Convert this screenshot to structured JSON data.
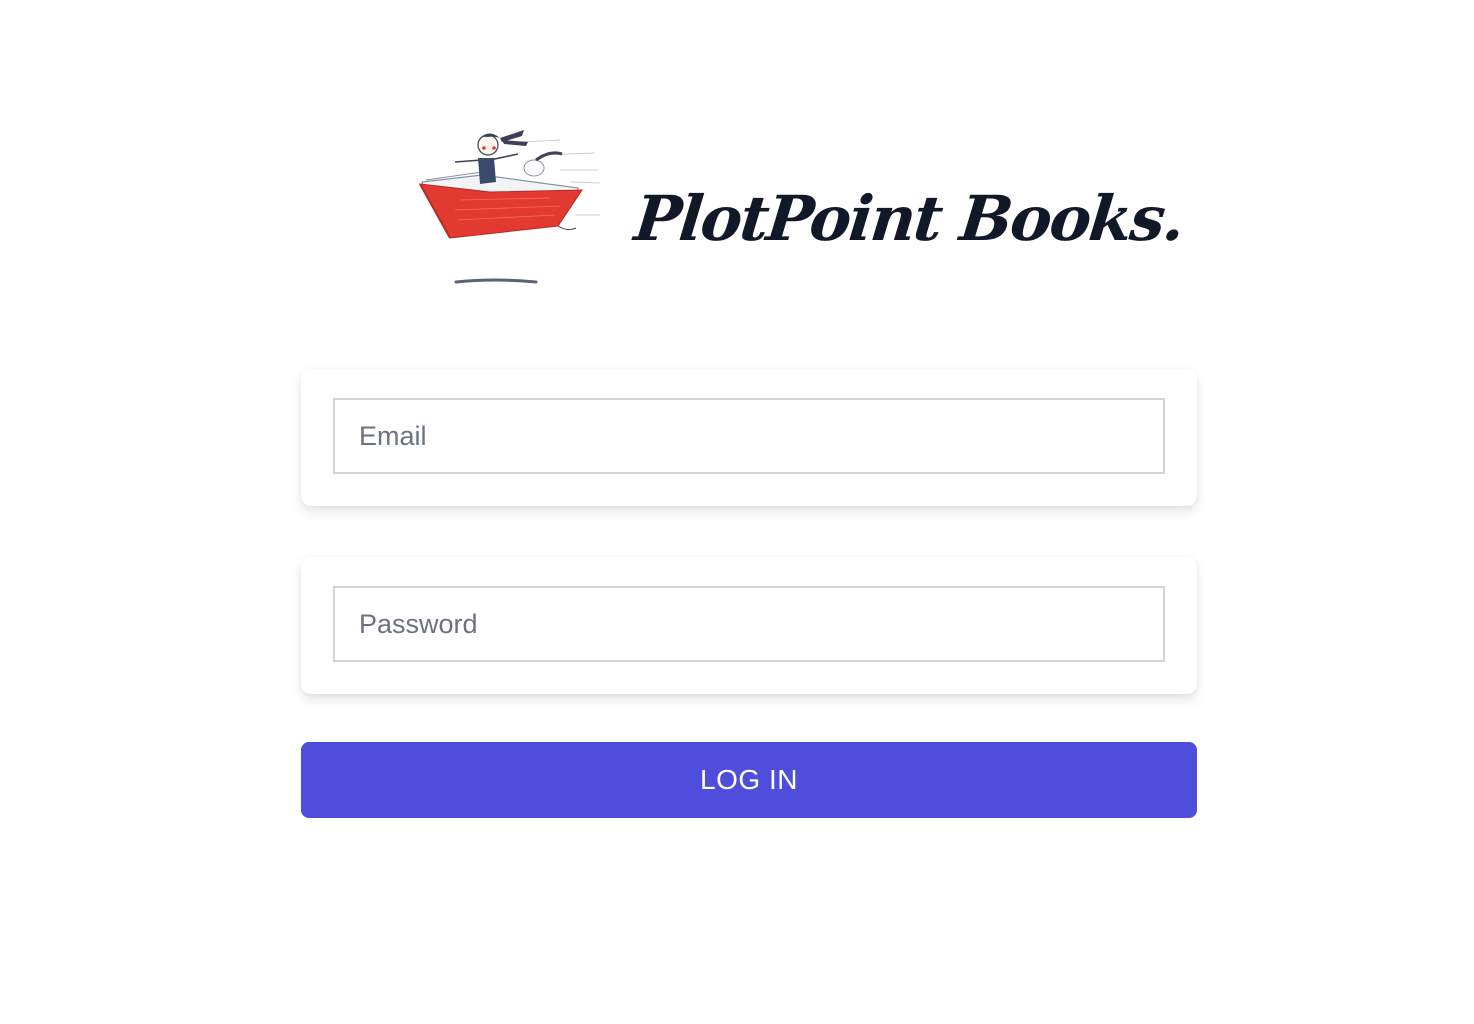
{
  "brand": {
    "name": "PlotPoint Books.",
    "logo_icon": "girl-flying-on-book-illustration"
  },
  "form": {
    "email": {
      "placeholder": "Email",
      "value": ""
    },
    "password": {
      "placeholder": "Password",
      "value": ""
    },
    "submit_label": "LOG IN"
  },
  "colors": {
    "accent": "#4f4edc",
    "book_red": "#e23a30",
    "brand_text": "#111827"
  }
}
